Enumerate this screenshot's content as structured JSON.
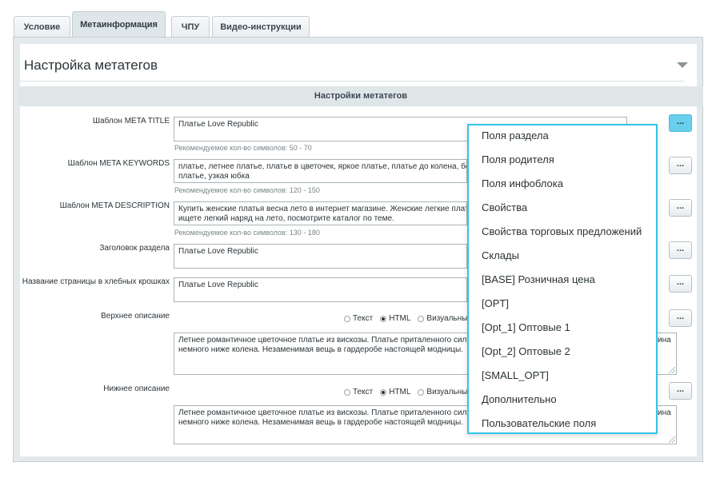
{
  "tabs": [
    "Условие",
    "Метаинформация",
    "ЧПУ",
    "Видео-инструкции"
  ],
  "section": {
    "title": "Настройка метатегов",
    "subheader": "Настройки метатегов"
  },
  "fields": [
    {
      "label": "Шаблон META TITLE",
      "value": "Платье Love Republic",
      "hint": "Рекомендуемое кол-во символов: 50 - 70"
    },
    {
      "label": "Шаблон META KEYWORDS",
      "value": "платье, летнее платье, платье в цветочек, яркое платье, платье до колена, бель",
      "value2": "платье, узкая юбка",
      "hint": "Рекомендуемое кол-во символов: 120 - 150"
    },
    {
      "label": "Шаблон META DESCRIPTION",
      "value": "Купить женские платья весна лето в интернет магазине. Женские легкие платья",
      "value2": "ищете легкий наряд на лето, посмотрите каталог по теме.",
      "hint": "Рекомендуемое кол-во символов: 130 - 180"
    },
    {
      "label": "Заголовок раздела",
      "value": "Платье Love Republic"
    },
    {
      "label": "Название страницы в хлебных крошках",
      "value": "Платье Love Republic"
    }
  ],
  "descriptions": [
    {
      "label": "Верхнее описание",
      "line1": "Летнее романтичное цветочное платье из вискозы. Платье приталенного силуэт",
      "line1_tail": "ина",
      "line2": "немного ниже колена. Незаменимая вещь в гардеробе настоящей модницы."
    },
    {
      "label": "Нижнее описание",
      "line1": "Летнее романтичное цветочное платье из вискозы. Платье приталенного силуэт",
      "line1_tail": "ина",
      "line2": "немного ниже колена. Незаменимая вещь в гардеробе настоящей модницы."
    }
  ],
  "radios": {
    "text": "Текст",
    "html": "HTML",
    "visual": "Визуальный"
  },
  "button_label": "...",
  "menu_items": [
    "Поля раздела",
    "Поля родителя",
    "Поля инфоблока",
    "Свойства",
    "Свойства торговых предложений",
    "Склады",
    "[BASE] Розничная цена",
    "[OPT]",
    "[Opt_1] Оптовые 1",
    "[Opt_2] Оптовые 2",
    "[SMALL_OPT]",
    "Дополнительно",
    "Пользовательские поля"
  ],
  "colors": {
    "accent": "#31c6e8",
    "active_button": "#68d0ed"
  }
}
